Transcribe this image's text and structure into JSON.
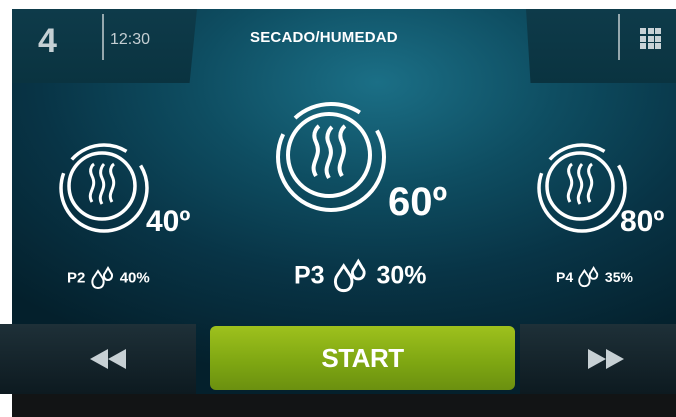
{
  "header": {
    "page_number": "4",
    "time": "12:30",
    "title": "SECADO/HUMEDAD"
  },
  "modes": [
    {
      "temperature": "40º",
      "program": "P2",
      "humidity": "40%"
    },
    {
      "temperature": "60º",
      "program": "P3",
      "humidity": "30%"
    },
    {
      "temperature": "80º",
      "program": "P4",
      "humidity": "35%"
    }
  ],
  "controls": {
    "start_label": "START",
    "prev_icon": "rewind-icon",
    "next_icon": "fast-forward-icon",
    "menu_icon": "grid-menu-icon"
  },
  "colors": {
    "accent": "#8db818",
    "background": "#0b3f52"
  }
}
